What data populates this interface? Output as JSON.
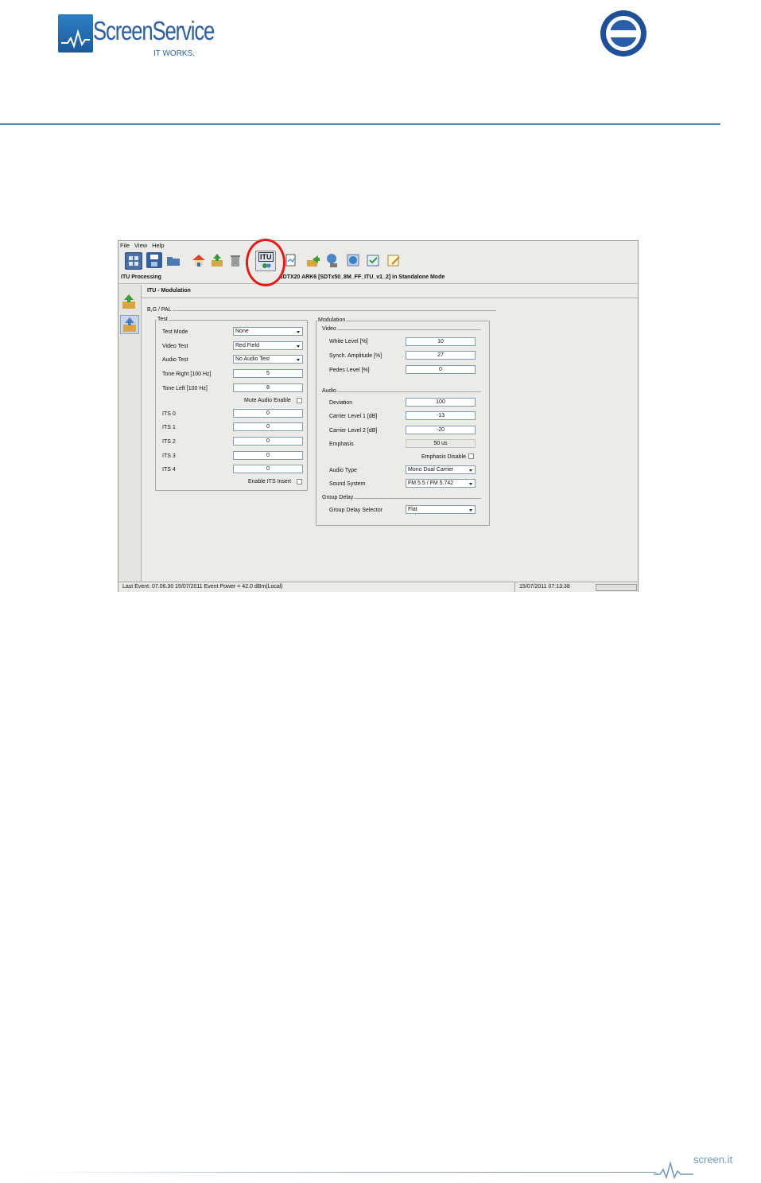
{
  "header": {
    "logo_name": "ScreenService",
    "logo_tagline": "IT WORKS.",
    "seal_text": "IQNet"
  },
  "footer": {
    "site": "screen.it"
  },
  "app": {
    "menu": [
      "File",
      "View",
      "Help"
    ],
    "toolbar_icons": [
      "device-grid-icon",
      "save-icon",
      "open-folder-icon",
      "home-icon",
      "box-up-icon",
      "trash-icon",
      "itu-icon",
      "report-icon",
      "export-icon",
      "network-icon",
      "globe-icon",
      "checklist-icon",
      "notes-icon"
    ],
    "itu_icon_label": "ITU",
    "processing_label": "ITU Processing",
    "mode_label": "SDTX20 ARK6 [SDTx50_8M_FF_ITU_v1_2] in Standalone Mode",
    "panel_title": "ITU - Modulation",
    "group_standard": "B,G / PAL",
    "test": {
      "title": "Test",
      "test_mode_label": "Test Mode",
      "test_mode_value": "None",
      "video_test_label": "Video Test",
      "video_test_value": "Red Field",
      "audio_test_label": "Audio Test",
      "audio_test_value": "No Audio Test",
      "tone_right_label": "Tone Right [100 Hz]",
      "tone_right_value": "5",
      "tone_left_label": "Tone Left [100 Hz]",
      "tone_left_value": "8",
      "mute_audio_label": "Mute Audio Enable",
      "its": [
        {
          "label": "ITS 0",
          "value": "0"
        },
        {
          "label": "ITS 1",
          "value": "0"
        },
        {
          "label": "ITS 2",
          "value": "0"
        },
        {
          "label": "ITS 3",
          "value": "0"
        },
        {
          "label": "ITS 4",
          "value": "0"
        }
      ],
      "enable_its_label": "Enable ITS Insert"
    },
    "modulation": {
      "title": "Modulation",
      "video_title": "Video",
      "white_level_label": "White Level [%]",
      "white_level_value": "10",
      "synch_amp_label": "Synch. Amplitude [%]",
      "synch_amp_value": "27",
      "pedes_label": "Pedes Level [%]",
      "pedes_value": "0",
      "audio_title": "Audio",
      "deviation_label": "Deviation",
      "deviation_value": "100",
      "carrier1_label": "Carrier Level 1 [dB]",
      "carrier1_value": "-13",
      "carrier2_label": "Carrier Level 2 [dB]",
      "carrier2_value": "-20",
      "emphasis_label": "Emphasis",
      "emphasis_value": "50 us",
      "emphasis_disable_label": "Emphasis Disable",
      "audio_type_label": "Audio Type",
      "audio_type_value": "Mono Dual Carrier",
      "sound_system_label": "Sound System",
      "sound_system_value": "FM 5.5 / FM 5.742",
      "group_delay_title": "Group Delay",
      "gd_selector_label": "Group Delay Selector",
      "gd_selector_value": "Flat"
    },
    "status": {
      "last_event": "Last Event: 07.06.30 15/07/2011 Event  Power = 42.0 dBm(Local)",
      "timestamp": "15/07/2011 07:13:38"
    }
  },
  "colors": {
    "brand": "#2b5f9e",
    "highlight": "#e21b1b"
  }
}
